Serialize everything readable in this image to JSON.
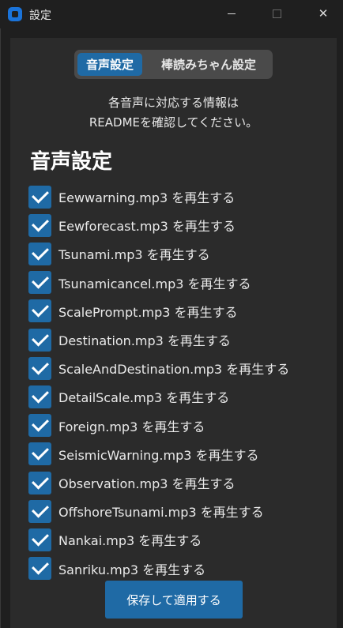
{
  "window": {
    "title": "設定",
    "icon": "app-icon",
    "controls": [
      "minimize-icon",
      "maximize-icon",
      "close-icon"
    ],
    "close_glyph": "✕"
  },
  "tabs": [
    {
      "label": "音声設定",
      "selected": true
    },
    {
      "label": "棒読みちゃん設定",
      "selected": false
    }
  ],
  "info": {
    "line1": "各音声に対応する情報は",
    "line2": "READMEを確認してください。"
  },
  "section_title": "音声設定",
  "options": [
    {
      "label": "Eewwarning.mp3 を再生する",
      "checked": true
    },
    {
      "label": "Eewforecast.mp3 を再生する",
      "checked": true
    },
    {
      "label": "Tsunami.mp3 を再生する",
      "checked": true
    },
    {
      "label": "Tsunamicancel.mp3 を再生する",
      "checked": true
    },
    {
      "label": "ScalePrompt.mp3 を再生する",
      "checked": true
    },
    {
      "label": "Destination.mp3 を再生する",
      "checked": true
    },
    {
      "label": "ScaleAndDestination.mp3 を再生する",
      "checked": true
    },
    {
      "label": "DetailScale.mp3 を再生する",
      "checked": true
    },
    {
      "label": "Foreign.mp3 を再生する",
      "checked": true
    },
    {
      "label": "SeismicWarning.mp3 を再生する",
      "checked": true
    },
    {
      "label": "Observation.mp3 を再生する",
      "checked": true
    },
    {
      "label": "OffshoreTsunami.mp3 を再生する",
      "checked": true
    },
    {
      "label": "Nankai.mp3 を再生する",
      "checked": true
    },
    {
      "label": "Sanriku.mp3 を再生する",
      "checked": true
    }
  ],
  "save_button": "保存して適用する",
  "colors": {
    "accent": "#1f6aa5",
    "panel": "#2b2b2b",
    "background": "#1f1f1f"
  }
}
